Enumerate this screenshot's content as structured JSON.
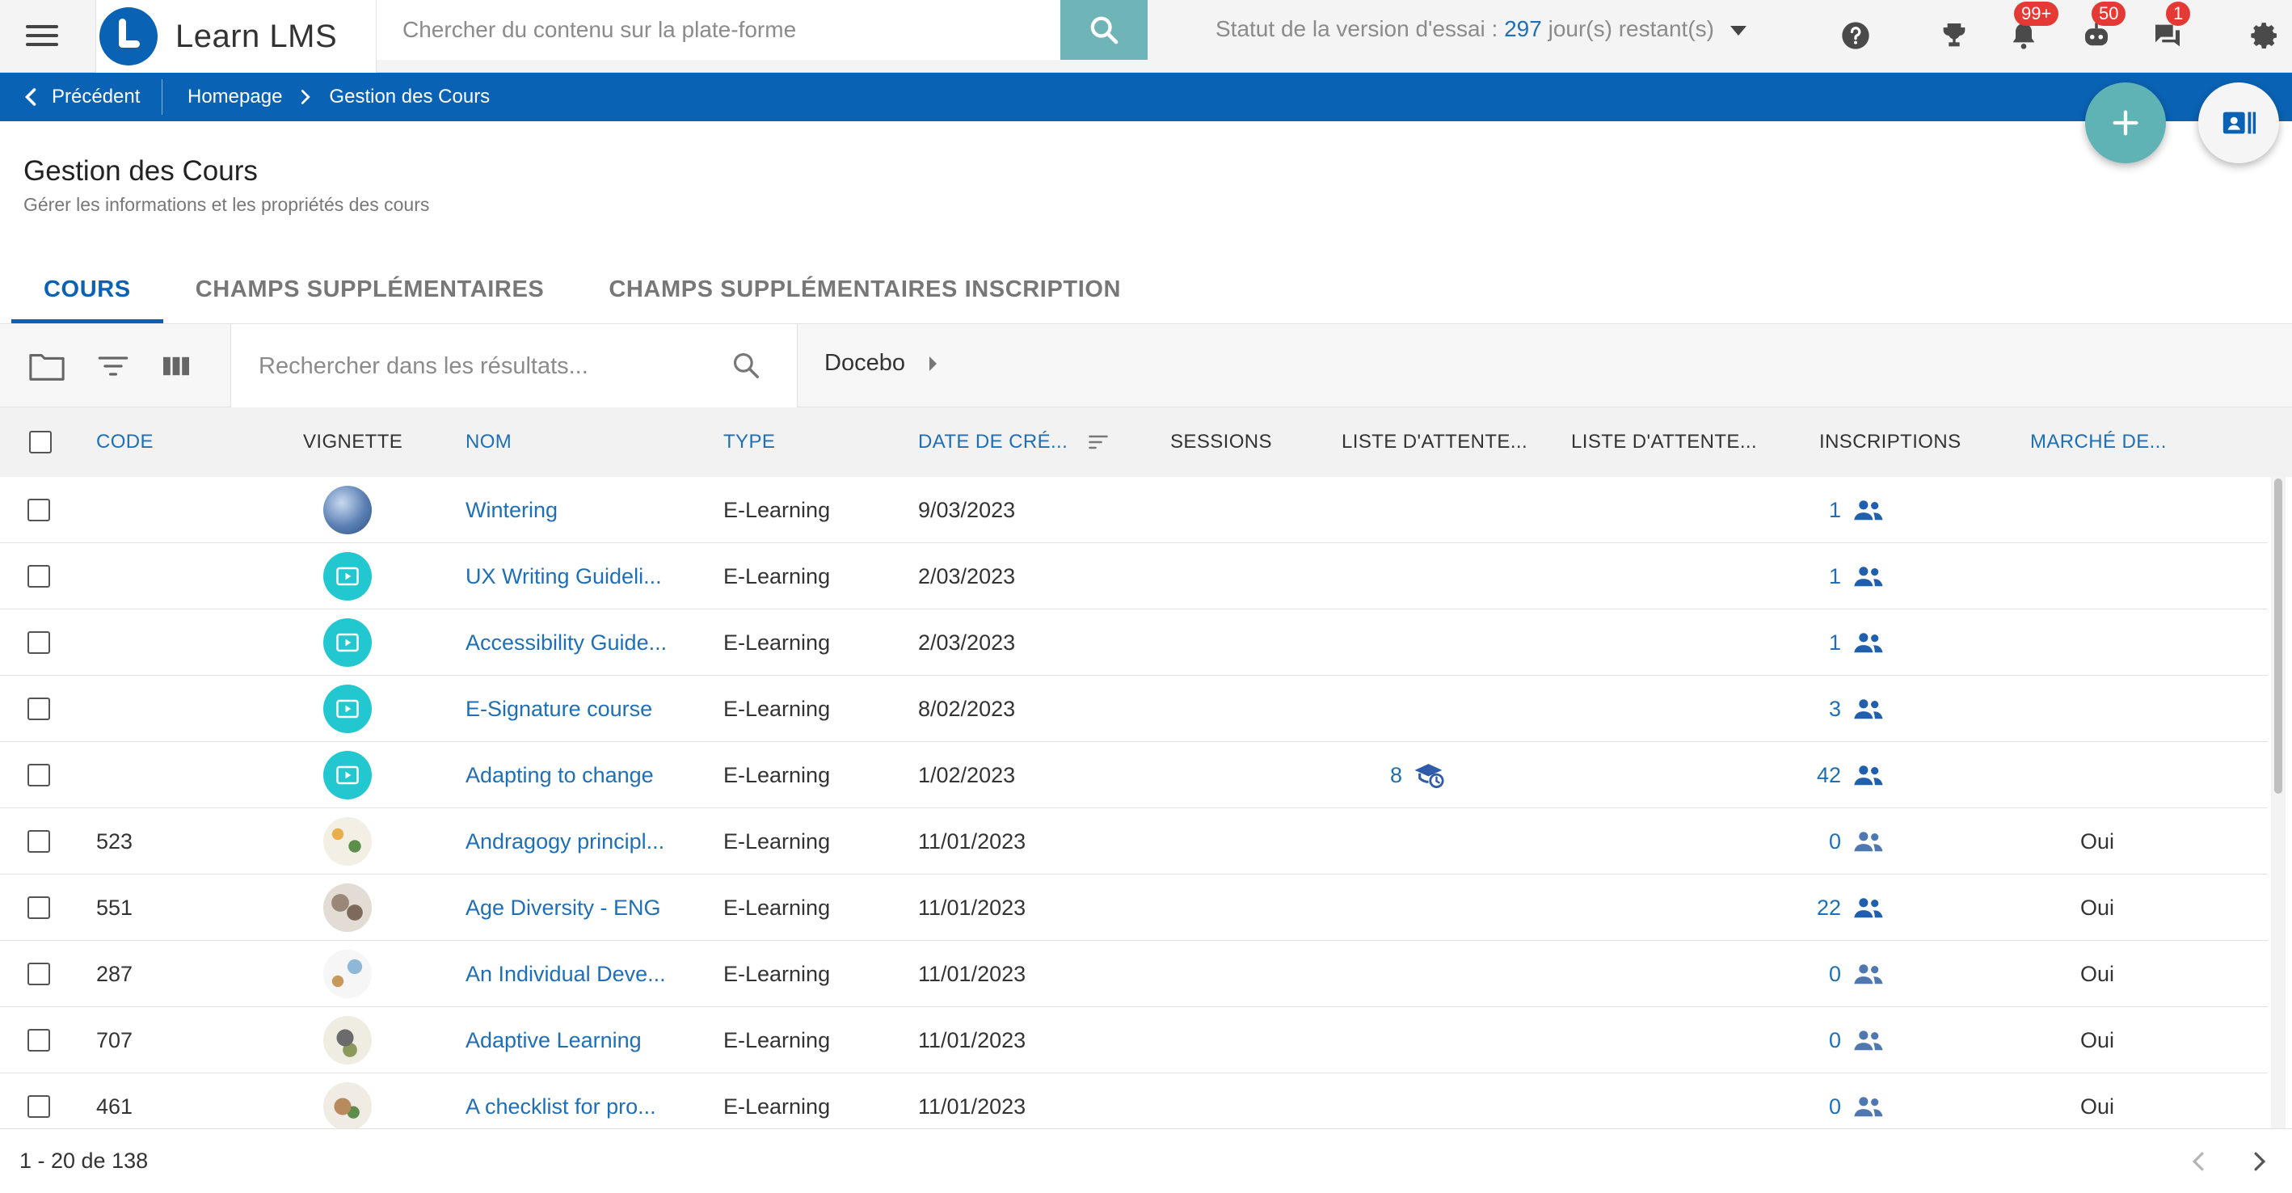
{
  "topbar": {
    "brand_name": "Learn LMS",
    "search_placeholder": "Chercher du contenu sur la plate-forme",
    "trial_prefix": "Statut de la version d'essai :",
    "trial_days": "297",
    "trial_suffix": "jour(s) restant(s)",
    "badges": {
      "notifications": "99+",
      "bot": "50",
      "messages": "1"
    },
    "icons": [
      "menu-icon",
      "search-icon",
      "help-icon",
      "trophy-icon",
      "bell-icon",
      "bot-icon",
      "chat-icon",
      "gear-icon"
    ]
  },
  "breadcrumb": {
    "back_label": "Précédent",
    "items": [
      "Homepage",
      "Gestion des Cours"
    ]
  },
  "page": {
    "title": "Gestion des Cours",
    "subtitle": "Gérer les informations et les propriétés des cours"
  },
  "tabs": [
    {
      "label": "COURS",
      "active": true
    },
    {
      "label": "CHAMPS SUPPLÉMENTAIRES",
      "active": false
    },
    {
      "label": "CHAMPS SUPPLÉMENTAIRES INSCRIPTION",
      "active": false
    }
  ],
  "toolbar": {
    "results_search_placeholder": "Rechercher dans les résultats...",
    "branch_label": "Docebo"
  },
  "table": {
    "headers": {
      "code": "CODE",
      "vignette": "VIGNETTE",
      "nom": "NOM",
      "type": "TYPE",
      "date": "DATE DE CRÉ...",
      "sessions": "SESSIONS",
      "waitlist1": "LISTE D'ATTENTE...",
      "waitlist2": "LISTE D'ATTENTE...",
      "inscriptions": "INSCRIPTIONS",
      "marche": "MARCHÉ DE..."
    },
    "rows": [
      {
        "code": "",
        "thumb": "globe",
        "name": "Wintering",
        "type": "E-Learning",
        "date": "9/03/2023",
        "waitlist": "",
        "enrollments": "1",
        "marche": ""
      },
      {
        "code": "",
        "thumb": "play",
        "name": "UX Writing Guideli...",
        "type": "E-Learning",
        "date": "2/03/2023",
        "waitlist": "",
        "enrollments": "1",
        "marche": ""
      },
      {
        "code": "",
        "thumb": "play",
        "name": "Accessibility Guide...",
        "type": "E-Learning",
        "date": "2/03/2023",
        "waitlist": "",
        "enrollments": "1",
        "marche": ""
      },
      {
        "code": "",
        "thumb": "play",
        "name": "E-Signature course",
        "type": "E-Learning",
        "date": "8/02/2023",
        "waitlist": "",
        "enrollments": "3",
        "marche": ""
      },
      {
        "code": "",
        "thumb": "play",
        "name": "Adapting to change",
        "type": "E-Learning",
        "date": "1/02/2023",
        "waitlist": "8",
        "enrollments": "42",
        "marche": ""
      },
      {
        "code": "523",
        "thumb": "art1",
        "name": "Andragogy principl...",
        "type": "E-Learning",
        "date": "11/01/2023",
        "waitlist": "",
        "enrollments": "0",
        "marche": "Oui"
      },
      {
        "code": "551",
        "thumb": "art2",
        "name": "Age Diversity - ENG",
        "type": "E-Learning",
        "date": "11/01/2023",
        "waitlist": "",
        "enrollments": "22",
        "marche": "Oui"
      },
      {
        "code": "287",
        "thumb": "art3",
        "name": "An Individual Deve...",
        "type": "E-Learning",
        "date": "11/01/2023",
        "waitlist": "",
        "enrollments": "0",
        "marche": "Oui"
      },
      {
        "code": "707",
        "thumb": "art4",
        "name": "Adaptive Learning",
        "type": "E-Learning",
        "date": "11/01/2023",
        "waitlist": "",
        "enrollments": "0",
        "marche": "Oui"
      },
      {
        "code": "461",
        "thumb": "art5",
        "name": "A checklist for pro...",
        "type": "E-Learning",
        "date": "11/01/2023",
        "waitlist": "",
        "enrollments": "0",
        "marche": "Oui"
      }
    ]
  },
  "pagination": {
    "label": "1 - 20 de 138"
  },
  "colors": {
    "brand_blue": "#0a62b4",
    "teal": "#5fb3b5",
    "badge_red": "#e53935",
    "link_blue": "#1e6fb6"
  }
}
